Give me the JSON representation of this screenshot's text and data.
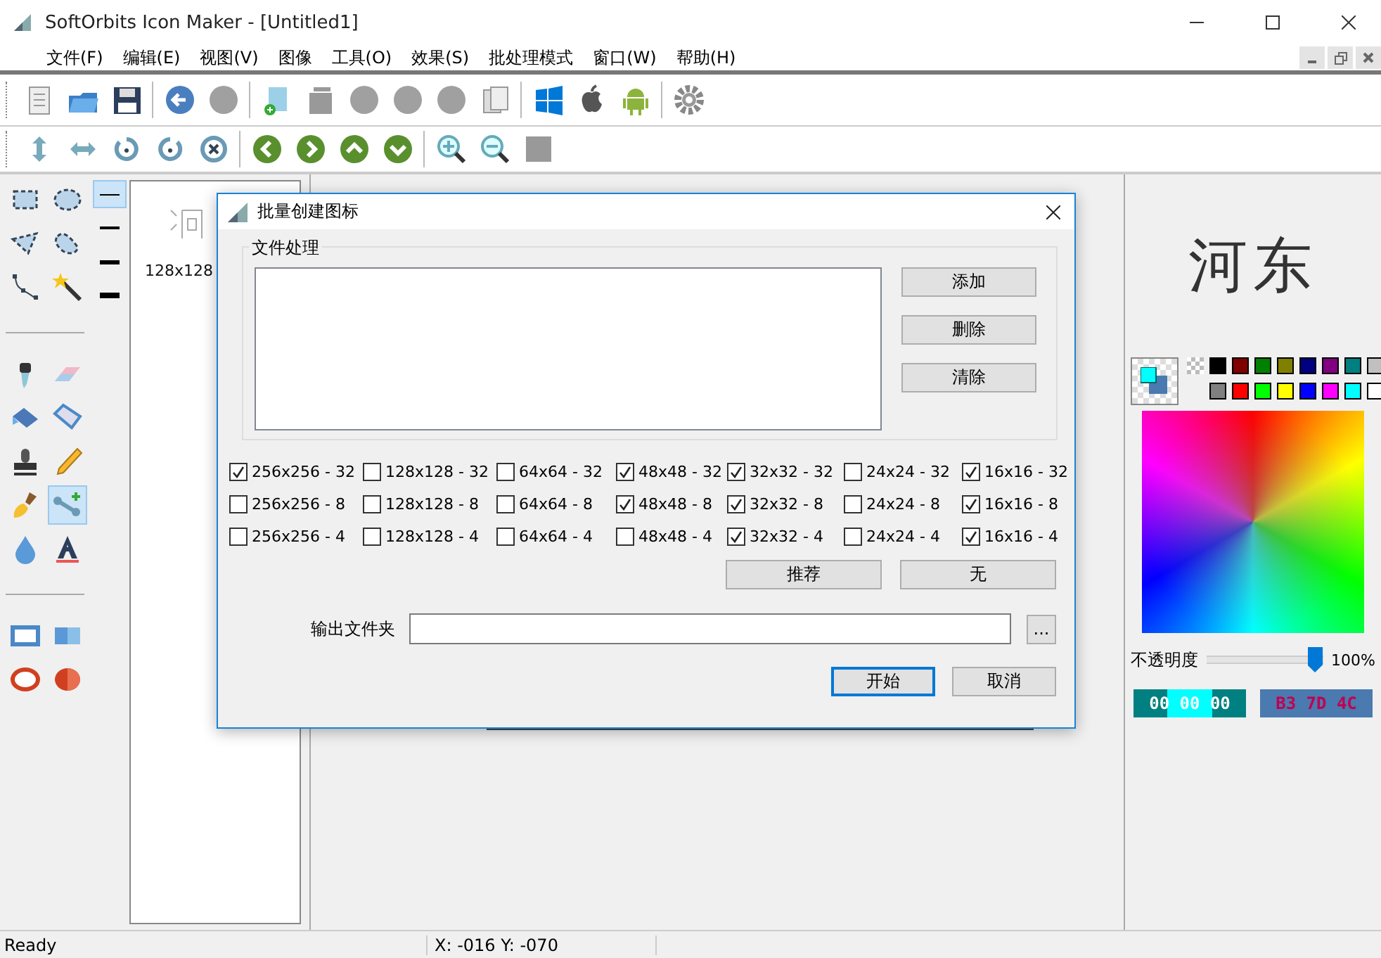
{
  "window": {
    "title": "SoftOrbits Icon Maker - [Untitled1]"
  },
  "menu": [
    "文件(F)",
    "编辑(E)",
    "视图(V)",
    "图像",
    "工具(O)",
    "效果(S)",
    "批处理模式",
    "窗口(W)",
    "帮助(H)"
  ],
  "tool_palette": [
    {
      "selected": false
    },
    {
      "selected": false
    },
    {
      "selected": false
    },
    {
      "selected": false
    },
    {
      "selected": false
    },
    {
      "selected": false
    },
    {
      "selected": false
    },
    {
      "selected": false
    },
    {
      "selected": false
    },
    {
      "selected": false
    },
    {
      "selected": false
    },
    {
      "selected": false
    },
    {
      "selected": false
    },
    {
      "selected": true
    },
    {
      "selected": false
    },
    {
      "selected": false
    },
    {
      "selected": false
    },
    {
      "selected": false
    },
    {
      "selected": false
    },
    {
      "selected": false
    }
  ],
  "line_widths": [
    {
      "selected": true
    },
    {
      "selected": false
    },
    {
      "selected": false
    },
    {
      "selected": false
    }
  ],
  "thumbnail": {
    "label": "128x128"
  },
  "preview": {
    "text": "河东"
  },
  "palette": [
    {
      "color": "#000000"
    },
    {
      "color": "#800000"
    },
    {
      "color": "#008000"
    },
    {
      "color": "#808000"
    },
    {
      "color": "#000080"
    },
    {
      "color": "#800080"
    },
    {
      "color": "#008080"
    },
    {
      "color": "#c0c0c0"
    },
    {
      "color": "#808080"
    },
    {
      "color": "#ff0000"
    },
    {
      "color": "#00ff00"
    },
    {
      "color": "#ffff00"
    },
    {
      "color": "#0000ff"
    },
    {
      "color": "#ff00ff"
    },
    {
      "color": "#00ffff"
    },
    {
      "color": "#ffffff"
    }
  ],
  "opacity": {
    "label": "不透明度",
    "level": 1,
    "reading": "100%"
  },
  "color_values": [
    "00 00 00",
    "B3 7D 4C"
  ],
  "dialog": {
    "title": "批量创建图标",
    "group_label": "文件处理",
    "file_buttons": [
      "添加",
      "删除",
      "清除"
    ],
    "sizes": [
      {
        "label": "256x256 - 32",
        "checked": true
      },
      {
        "label": "128x128 - 32",
        "checked": false
      },
      {
        "label": "64x64 - 32",
        "checked": false
      },
      {
        "label": "48x48 - 32",
        "checked": true
      },
      {
        "label": "32x32 - 32",
        "checked": true
      },
      {
        "label": "24x24 - 32",
        "checked": false
      },
      {
        "label": "16x16 - 32",
        "checked": true
      },
      {
        "label": "256x256 - 8",
        "checked": false
      },
      {
        "label": "128x128 - 8",
        "checked": false
      },
      {
        "label": "64x64 - 8",
        "checked": false
      },
      {
        "label": "48x48 - 8",
        "checked": true
      },
      {
        "label": "32x32 - 8",
        "checked": true
      },
      {
        "label": "24x24 - 8",
        "checked": false
      },
      {
        "label": "16x16 - 8",
        "checked": true
      },
      {
        "label": "256x256 - 4",
        "checked": false
      },
      {
        "label": "128x128 - 4",
        "checked": false
      },
      {
        "label": "64x64 - 4",
        "checked": false
      },
      {
        "label": "48x48 - 4",
        "checked": false
      },
      {
        "label": "32x32 - 4",
        "checked": true
      },
      {
        "label": "24x24 - 4",
        "checked": false
      },
      {
        "label": "16x16 - 4",
        "checked": true
      }
    ],
    "preset_buttons": [
      "推荐",
      "无"
    ],
    "output_label": "输出文件夹",
    "browse_button": "...",
    "ok_button": "开始",
    "cancel_button": "取消"
  },
  "status_bar": {
    "message": "Ready",
    "coords": "X: -016 Y: -070"
  }
}
